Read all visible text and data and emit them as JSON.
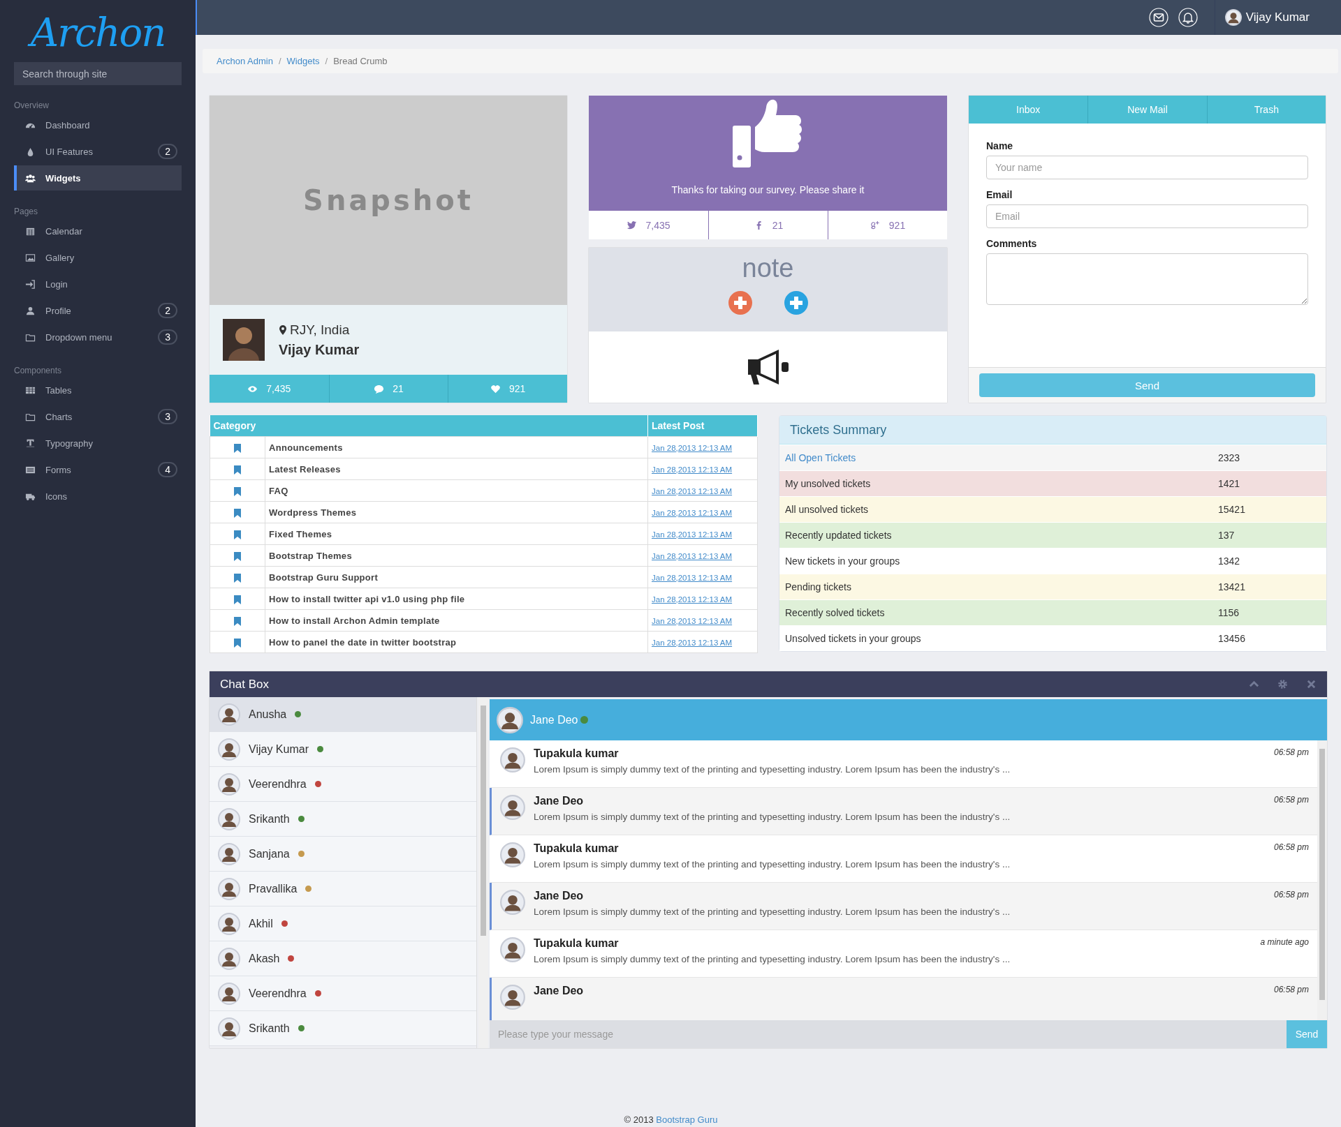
{
  "sidebar": {
    "logo": "Archon",
    "search": {
      "placeholder": "Search through site"
    },
    "sections": [
      {
        "title": "Overview",
        "items": [
          {
            "label": "Dashboard",
            "selected": false
          },
          {
            "label": "UI Features",
            "badge": "2",
            "selected": false
          },
          {
            "label": "Widgets",
            "selected": true
          }
        ]
      },
      {
        "title": "Pages",
        "items": [
          {
            "label": "Calendar",
            "selected": false
          },
          {
            "label": "Gallery",
            "selected": false
          },
          {
            "label": "Login",
            "selected": false
          },
          {
            "label": "Profile",
            "badge": "2",
            "selected": false
          },
          {
            "label": "Dropdown menu",
            "badge": "3",
            "selected": false
          }
        ]
      },
      {
        "title": "Components",
        "items": [
          {
            "label": "Tables",
            "selected": false
          },
          {
            "label": "Charts",
            "badge": "3",
            "selected": false
          },
          {
            "label": "Typography",
            "selected": false
          },
          {
            "label": "Forms",
            "badge": "4",
            "selected": false
          },
          {
            "label": "Icons",
            "selected": false
          }
        ]
      }
    ]
  },
  "topbar": {
    "user": "Vijay Kumar"
  },
  "breadcrumb": {
    "separator": "/",
    "items": [
      {
        "label": "Archon Admin",
        "kind": "link"
      },
      {
        "label": "Widgets",
        "kind": "link"
      },
      {
        "label": "Bread Crumb",
        "kind": "current"
      }
    ]
  },
  "profile_card": {
    "image_text": "Snapshot",
    "location": "RJY, India",
    "name": "Vijay Kumar",
    "stats": [
      "7,435",
      "21",
      "921"
    ]
  },
  "survey_card": {
    "message": "Thanks for taking our survey. Please share it",
    "shares": [
      "7,435",
      "21",
      "921"
    ]
  },
  "note_card": {
    "title": "note"
  },
  "mail_card": {
    "tabs": [
      "Inbox",
      "New Mail",
      "Trash"
    ],
    "fields": [
      {
        "label": "Name",
        "placeholder": "Your name",
        "kind": "input"
      },
      {
        "label": "Email",
        "placeholder": "Email",
        "kind": "input"
      },
      {
        "label": "Comments",
        "kind": "textarea"
      }
    ],
    "button": "Send"
  },
  "posts_table": {
    "columns": [
      "Category",
      "Latest Post"
    ],
    "rows": [
      {
        "category": "Announcements",
        "latest_post": "Jan 28,2013 12:13 AM"
      },
      {
        "category": "Latest Releases",
        "latest_post": "Jan 28,2013 12:13 AM"
      },
      {
        "category": "FAQ",
        "latest_post": "Jan 28,2013 12:13 AM"
      },
      {
        "category": "Wordpress Themes",
        "latest_post": "Jan 28,2013 12:13 AM"
      },
      {
        "category": "Fixed Themes",
        "latest_post": "Jan 28,2013 12:13 AM"
      },
      {
        "category": "Bootstrap Themes",
        "latest_post": "Jan 28,2013 12:13 AM"
      },
      {
        "category": "Bootstrap Guru Support",
        "latest_post": "Jan 28,2013 12:13 AM"
      },
      {
        "category": "How to install twitter api v1.0 using php file",
        "latest_post": "Jan 28,2013 12:13 AM"
      },
      {
        "category": "How to install Archon Admin template",
        "latest_post": "Jan 28,2013 12:13 AM"
      },
      {
        "category": "How to panel the date in twitter bootstrap",
        "latest_post": "Jan 28,2013 12:13 AM"
      }
    ]
  },
  "tickets": {
    "title": "Tickets Summary",
    "rows": [
      {
        "label": "All Open Tickets",
        "count": "2323",
        "kind": "active"
      },
      {
        "label": "My unsolved tickets",
        "count": "1421",
        "kind": "danger"
      },
      {
        "label": "All unsolved tickets",
        "count": "15421",
        "kind": "warning"
      },
      {
        "label": "Recently updated tickets",
        "count": "137",
        "kind": "success"
      },
      {
        "label": "New tickets in your groups",
        "count": "1342",
        "kind": "default"
      },
      {
        "label": "Pending tickets",
        "count": "13421",
        "kind": "warning"
      },
      {
        "label": "Recently solved tickets",
        "count": "1156",
        "kind": "success"
      },
      {
        "label": "Unsolved tickets in your groups",
        "count": "13456",
        "kind": "default"
      }
    ]
  },
  "chat": {
    "title": "Chat Box",
    "contacts": [
      {
        "name": "Anusha",
        "color": "#4a8a3e",
        "selected": true
      },
      {
        "name": "Vijay Kumar",
        "color": "#4a8a3e",
        "selected": false
      },
      {
        "name": "Veerendhra",
        "color": "#c0453f",
        "selected": false
      },
      {
        "name": "Srikanth",
        "color": "#4a8a3e",
        "selected": false
      },
      {
        "name": "Sanjana",
        "color": "#c59a4f",
        "selected": false
      },
      {
        "name": "Pravallika",
        "color": "#c59a4f",
        "selected": false
      },
      {
        "name": "Akhil",
        "color": "#c0453f",
        "selected": false
      },
      {
        "name": "Akash",
        "color": "#c0453f",
        "selected": false
      },
      {
        "name": "Veerendhra",
        "color": "#c0453f",
        "selected": false
      },
      {
        "name": "Srikanth",
        "color": "#4a8a3e",
        "selected": false
      }
    ],
    "active_contact": {
      "name": "Jane Deo",
      "color": "#4a8a3e"
    },
    "messages": [
      {
        "author": "Tupakula kumar",
        "time": "06:58 pm",
        "text": "Lorem Ipsum is simply dummy text of the printing and typesetting industry. Lorem Ipsum has been the industry's ...",
        "kind": "incoming"
      },
      {
        "author": "Jane Deo",
        "time": "06:58 pm",
        "text": "Lorem Ipsum is simply dummy text of the printing and typesetting industry. Lorem Ipsum has been the industry's ...",
        "kind": "outgoing"
      },
      {
        "author": "Tupakula kumar",
        "time": "06:58 pm",
        "text": "Lorem Ipsum is simply dummy text of the printing and typesetting industry. Lorem Ipsum has been the industry's ...",
        "kind": "incoming"
      },
      {
        "author": "Jane Deo",
        "time": "06:58 pm",
        "text": "Lorem Ipsum is simply dummy text of the printing and typesetting industry. Lorem Ipsum has been the industry's ...",
        "kind": "outgoing"
      },
      {
        "author": "Tupakula kumar",
        "time": "a minute ago",
        "text": "Lorem Ipsum is simply dummy text of the printing and typesetting industry. Lorem Ipsum has been the industry's ...",
        "kind": "incoming"
      },
      {
        "author": "Jane Deo",
        "time": "06:58 pm",
        "kind": "outgoing"
      }
    ],
    "input": {
      "placeholder": "Please type your message"
    },
    "button": "Send"
  },
  "footer": {
    "text": "© 2013",
    "link": "Bootstrap Guru"
  }
}
